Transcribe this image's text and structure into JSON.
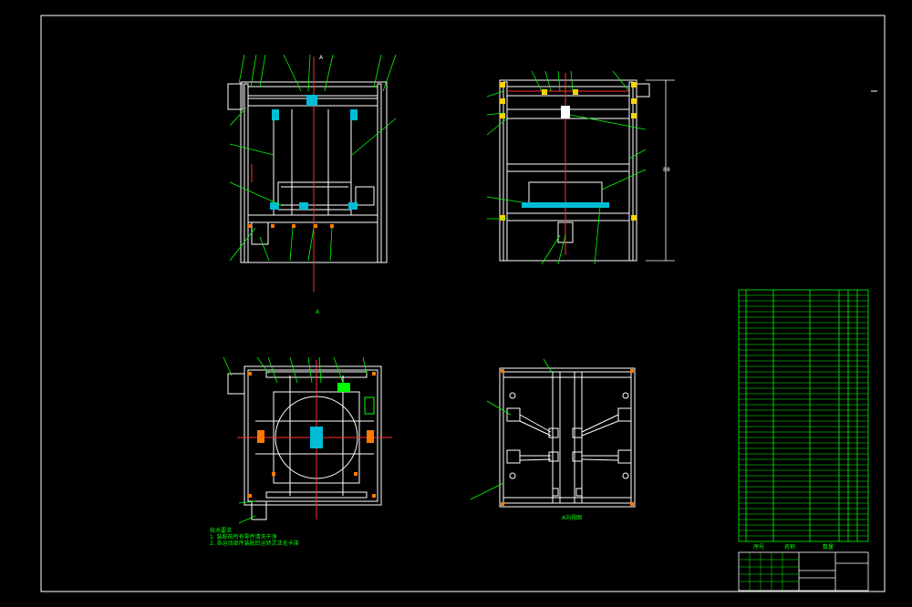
{
  "drawing": {
    "colors": {
      "background": "#000000",
      "frame": "#ffffff",
      "annotation": "#00ff00",
      "centerline": "#ff3030",
      "accent": "#00e5ff",
      "hardware": "#ffd400",
      "parts": "#ff7a00"
    },
    "dimension_label": "88",
    "section_label": "A",
    "view_mark": "A",
    "note_lines": [
      "技术要求",
      "1. 装配前所有零件清洗干净",
      "2. 各运动部件装配后运转灵活无卡滞"
    ],
    "bom_header": {
      "seq": "序号",
      "name": "名称",
      "qty": "数量"
    },
    "view_a_caption": "A向视图"
  }
}
